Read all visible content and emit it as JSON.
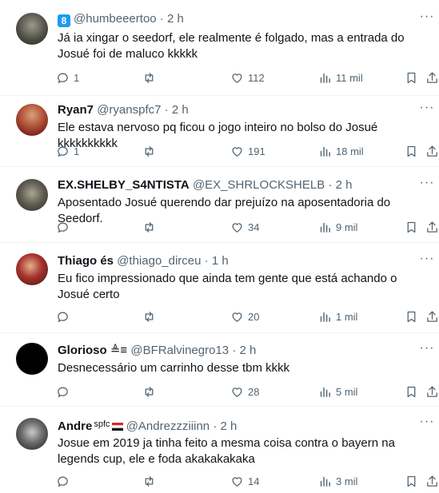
{
  "tweets": [
    {
      "name": "",
      "badge": "8",
      "handle": "@humbeeertoo",
      "time": "2 h",
      "text": "Já ia xingar o seedorf, ele realmente é folgado, mas a entrada do Josué foi de maluco kkkkk",
      "replies": "1",
      "retweets": "",
      "likes": "112",
      "views": "11 mil"
    },
    {
      "name": "Ryan7",
      "handle": "@ryanspfc7",
      "time": "2 h",
      "text": "Ele estava nervoso pq ficou o jogo inteiro no bolso do Josué kkkkkkkkkk",
      "replies": "1",
      "retweets": "",
      "likes": "191",
      "views": "18 mil"
    },
    {
      "name": "EX.SHELBY_S4NTISTA",
      "handle": "@EX_SHRLOCKSHELB",
      "time": "2 h",
      "text": "Aposentado Josué querendo dar prejuízo na aposentadoria do Seedorf.",
      "replies": "",
      "retweets": "",
      "likes": "34",
      "views": "9 mil"
    },
    {
      "name": "Thiago és",
      "handle": "@thiago_dirceu",
      "time": "1 h",
      "text": "Eu fico impressionado que ainda tem gente que está achando o Josué certo",
      "replies": "",
      "retweets": "",
      "likes": "20",
      "views": "1 mil"
    },
    {
      "name": "Glorioso",
      "name_suffix": "≜≡",
      "handle": "@BFRalvinegro13",
      "time": "2 h",
      "text": "Desnecessário um carrinho desse tbm kkkk",
      "replies": "",
      "retweets": "",
      "likes": "28",
      "views": "5 mil"
    },
    {
      "name": "Andre",
      "name_suffix": "spfc",
      "handle": "@Andrezzziiinn",
      "time": "2 h",
      "text": "Josue em 2019 ja tinha feito a mesma coisa contra o bayern na legends cup, ele e foda akakakakaka",
      "replies": "",
      "retweets": "",
      "likes": "14",
      "views": "3 mil"
    }
  ],
  "dot": "·",
  "more_label": "···",
  "colors": {
    "text": "#0f1419",
    "secondary": "#536471",
    "divider": "#eff3f4",
    "accent": "#1d9bf0"
  },
  "icons": {
    "reply": "reply-icon",
    "retweet": "retweet-icon",
    "like": "like-icon",
    "views": "views-icon",
    "bookmark": "bookmark-icon",
    "share": "share-icon"
  }
}
